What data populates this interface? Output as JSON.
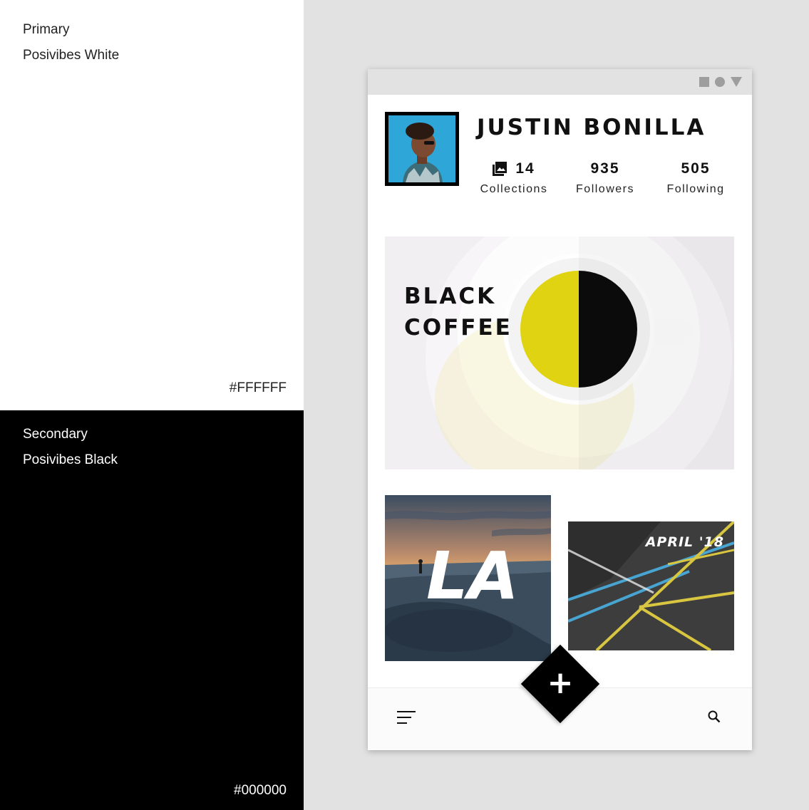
{
  "palette": {
    "primary": {
      "role": "Primary",
      "name": "Posivibes White",
      "hex": "#FFFFFF"
    },
    "secondary": {
      "role": "Secondary",
      "name": "Posivibes Black",
      "hex": "#000000"
    }
  },
  "status_bar": {
    "icons": [
      "square-icon",
      "circle-icon",
      "triangle-icon"
    ]
  },
  "profile": {
    "name": "JUSTIN BONILLA",
    "stats": [
      {
        "value": "14",
        "label": "Collections",
        "icon": "collections-icon"
      },
      {
        "value": "935",
        "label": "Followers"
      },
      {
        "value": "505",
        "label": "Following"
      }
    ]
  },
  "cards": {
    "coffee": {
      "title_line1": "BLACK",
      "title_line2": "COFFEE",
      "accent": "#e0d412"
    },
    "la": {
      "title": "LA"
    },
    "april": {
      "title": "APRIL '18"
    }
  },
  "bottom_bar": {
    "fab_label": "+",
    "left_icon": "menu-icon",
    "right_icon": "search-icon"
  }
}
